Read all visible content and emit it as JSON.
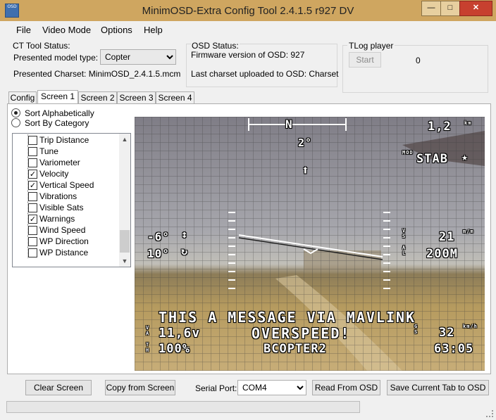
{
  "window": {
    "title": "MinimOSD-Extra Config Tool 2.4.1.5 r927 DV",
    "icon_text": "OSD"
  },
  "menu": [
    "File",
    "Video Mode",
    "Options",
    "Help"
  ],
  "ct_status": {
    "label": "CT Tool Status:",
    "model_label": "Presented model type:",
    "model_value": "Copter",
    "charset_label": "Presented Charset: MinimOSD_2.4.1.5.mcm"
  },
  "osd_status": {
    "label": "OSD Status:",
    "firmware": "Firmware version of OSD: 927",
    "charset": "Last charset uploaded to OSD: Charset"
  },
  "tlog": {
    "label": "TLog player",
    "start_label": "Start",
    "value": "0"
  },
  "tabs": [
    "Config",
    "Screen 1",
    "Screen 2",
    "Screen 3",
    "Screen 4"
  ],
  "active_tab": "Screen 1",
  "sort": {
    "alpha": "Sort Alphabetically",
    "category": "Sort By Category",
    "selected": "alpha"
  },
  "items": [
    {
      "label": "Trip Distance",
      "checked": false
    },
    {
      "label": "Tune",
      "checked": false
    },
    {
      "label": "Variometer",
      "checked": false
    },
    {
      "label": "Velocity",
      "checked": true
    },
    {
      "label": "Vertical Speed",
      "checked": true
    },
    {
      "label": "Vibrations",
      "checked": false
    },
    {
      "label": "Visible Sats",
      "checked": false
    },
    {
      "label": "Warnings",
      "checked": true
    },
    {
      "label": "Wind Speed",
      "checked": false
    },
    {
      "label": "WP Direction",
      "checked": false
    },
    {
      "label": "WP Distance",
      "checked": false
    }
  ],
  "osd": {
    "heading": "N",
    "distance": "1,2",
    "distance_unit": "km",
    "heading_deg": "2°",
    "mode_tag": "MOD",
    "mode": "STAB",
    "pitch": "-6°",
    "roll": "10°",
    "climb": "21",
    "climb_unit": "m/m",
    "altitude": "200M",
    "message": "THIS A MESSAGE VIA MAVLINK",
    "voltage": "11,6v",
    "warning": "OVERSPEED!",
    "speed": "32",
    "speed_unit": "km/h",
    "throttle": "100%",
    "callsign": "BCOPTER2",
    "flight_time": "63:05"
  },
  "bottom": {
    "clear": "Clear Screen",
    "copy": "Copy from Screen",
    "serial_label": "Serial Port:",
    "serial_value": "COM4",
    "read": "Read From OSD",
    "save": "Save Current Tab to OSD"
  },
  "colors": {
    "title_bar": "#cfa660",
    "close_button": "#c7402f"
  }
}
